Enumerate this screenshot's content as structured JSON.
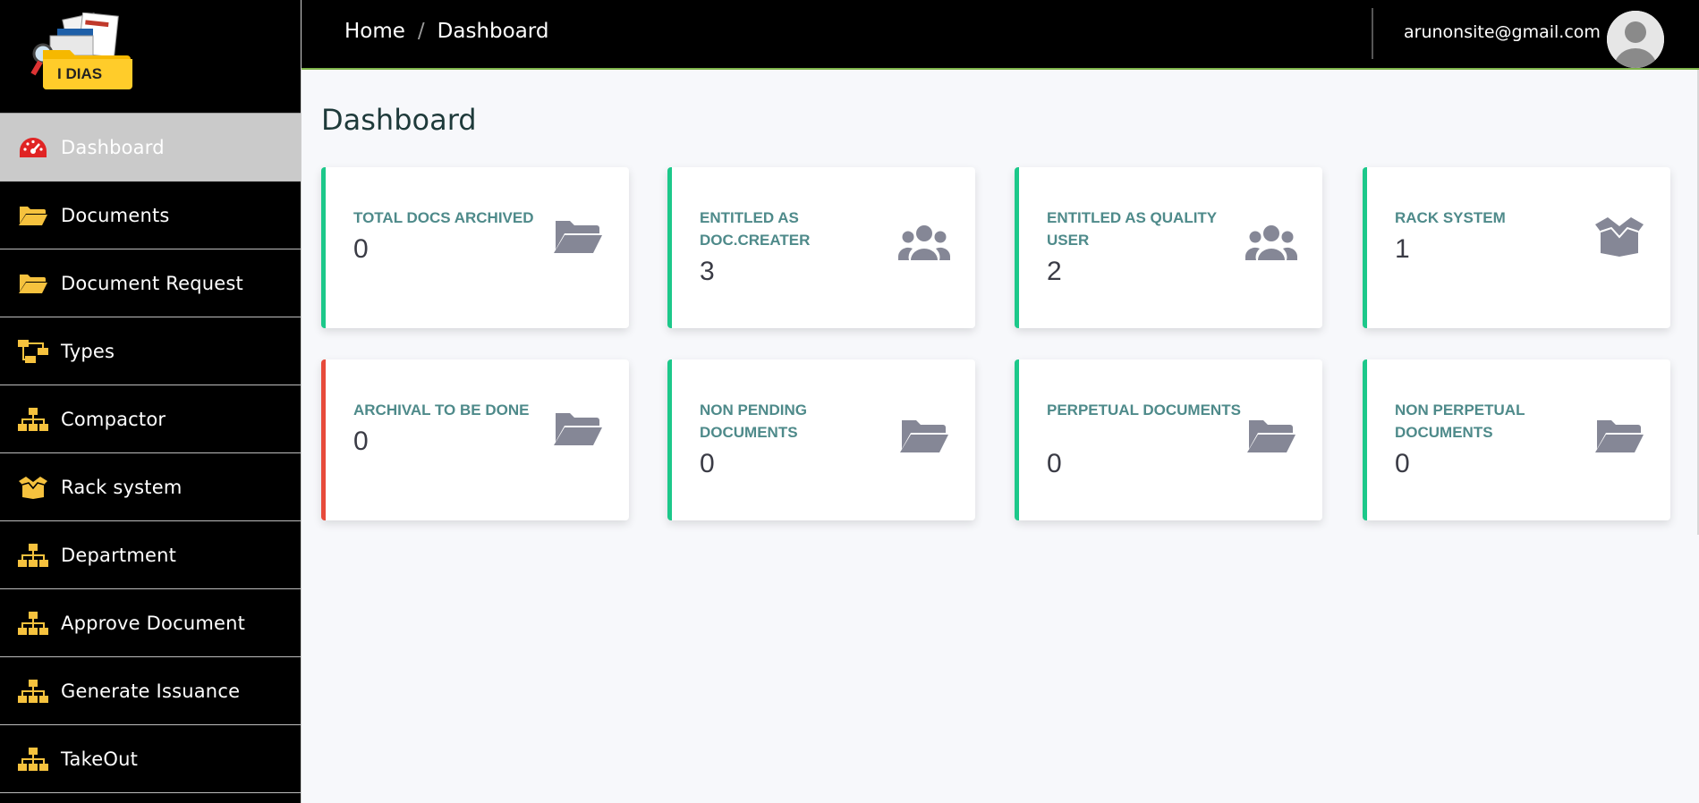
{
  "app": {
    "logo_text": "I DIAS"
  },
  "sidebar": {
    "items": [
      {
        "label": "Dashboard",
        "icon": "tachometer-icon",
        "active": true
      },
      {
        "label": "Documents",
        "icon": "folder-open-icon"
      },
      {
        "label": "Document Request",
        "icon": "folder-open-icon"
      },
      {
        "label": "Types",
        "icon": "project-diagram-icon"
      },
      {
        "label": "Compactor",
        "icon": "sitemap-icon"
      },
      {
        "label": "Rack system",
        "icon": "box-open-icon"
      },
      {
        "label": "Department",
        "icon": "sitemap-icon"
      },
      {
        "label": "Approve Document",
        "icon": "sitemap-icon"
      },
      {
        "label": "Generate Issuance",
        "icon": "sitemap-icon"
      },
      {
        "label": "TakeOut",
        "icon": "sitemap-icon"
      }
    ]
  },
  "header": {
    "breadcrumb": [
      "Home",
      "Dashboard"
    ],
    "separator": "/",
    "user_email": "arunonsite@gmail.com"
  },
  "main": {
    "title": "Dashboard",
    "cards": [
      {
        "title": "TOTAL DOCS ARCHIVED",
        "value": "0",
        "icon": "folder-open-icon",
        "status": "success"
      },
      {
        "title": "ENTITLED AS DOC.CREATER",
        "value": "3",
        "icon": "users-icon",
        "status": "success"
      },
      {
        "title": "ENTITLED AS QUALITY USER",
        "value": "2",
        "icon": "users-icon",
        "status": "success"
      },
      {
        "title": "RACK SYSTEM",
        "value": "1",
        "icon": "box-open-icon",
        "status": "success"
      },
      {
        "title": "ARCHIVAL TO BE DONE",
        "value": "0",
        "icon": "folder-open-icon",
        "status": "danger"
      },
      {
        "title": "NON PENDING DOCUMENTS",
        "value": "0",
        "icon": "folder-open-icon",
        "status": "success"
      },
      {
        "title": "PERPETUAL DOCUMENTS",
        "value": "0",
        "icon": "folder-open-icon",
        "status": "success"
      },
      {
        "title": "NON PERPETUAL DOCUMENTS",
        "value": "0",
        "icon": "folder-open-icon",
        "status": "success"
      }
    ]
  },
  "colors": {
    "success": "#1cc88a",
    "danger": "#e74a3b",
    "sidebar_icon": "#f6c23e",
    "card_title": "#4e8a8a",
    "card_icon": "#858796"
  }
}
